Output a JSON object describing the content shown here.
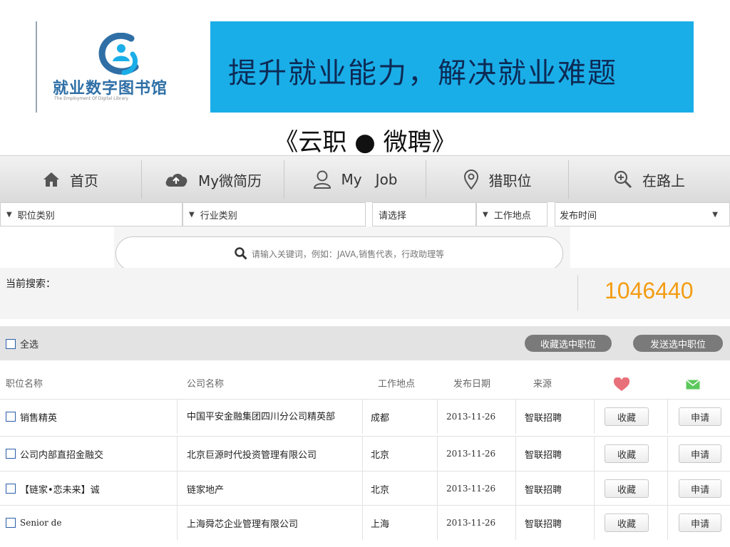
{
  "banner": {
    "logo_text": "就业数字图书馆",
    "logo_sub": "The Employment Of Digital Library",
    "slogan": "提升就业能力，解决就业难题"
  },
  "subtitle": "《云职 ● 微聘》",
  "nav": [
    {
      "label": "首页",
      "icon": "home-icon"
    },
    {
      "label": "My微简历",
      "icon": "cloud-upload-icon"
    },
    {
      "label": "My   Job",
      "icon": "user-icon"
    },
    {
      "label": "猎职位",
      "icon": "location-pin-icon"
    },
    {
      "label": "在路上",
      "icon": "zoom-in-icon"
    }
  ],
  "filters": {
    "job_category": "职位类别",
    "industry_category": "行业类别",
    "please_select": "请选择",
    "work_location": "工作地点",
    "publish_time": "发布时间"
  },
  "search": {
    "placeholder": "请输入关键词，例如：JAVA,销售代表，行政助理等"
  },
  "current_search": {
    "label": "当前搜索：",
    "count": "1046440"
  },
  "select_bar": {
    "select_all": "全选",
    "favorite_selected": "收藏选中职位",
    "send_selected": "发送选中职位"
  },
  "table": {
    "headers": {
      "title": "职位名称",
      "company": "公司名称",
      "location": "工作地点",
      "date": "发布日期",
      "source": "来源"
    },
    "rows": [
      {
        "title": "销售精英",
        "company": "中国平安金融集团四川分公司精英部",
        "location": "成都",
        "date": "2013-11-26",
        "source": "智联招聘",
        "fav": "收藏",
        "apply": "申请"
      },
      {
        "title": "公司内部直招金融交",
        "company": "北京巨源时代投资管理有限公司",
        "location": "北京",
        "date": "2013-11-26",
        "source": "智联招聘",
        "fav": "收藏",
        "apply": "申请"
      },
      {
        "title": "【链家•恋未来】诚",
        "company": "链家地产",
        "location": "北京",
        "date": "2013-11-26",
        "source": "智联招聘",
        "fav": "收藏",
        "apply": "申请"
      },
      {
        "title": "Senior de",
        "company": "上海舜芯企业管理有限公司",
        "location": "上海",
        "date": "2013-11-26",
        "source": "智联招聘",
        "fav": "收藏",
        "apply": "申请"
      }
    ]
  },
  "colors": {
    "banner_blue": "#1aaee8",
    "count_orange": "#f39c12",
    "heart_pink": "#e8707a",
    "mail_green": "#5cc85c"
  }
}
